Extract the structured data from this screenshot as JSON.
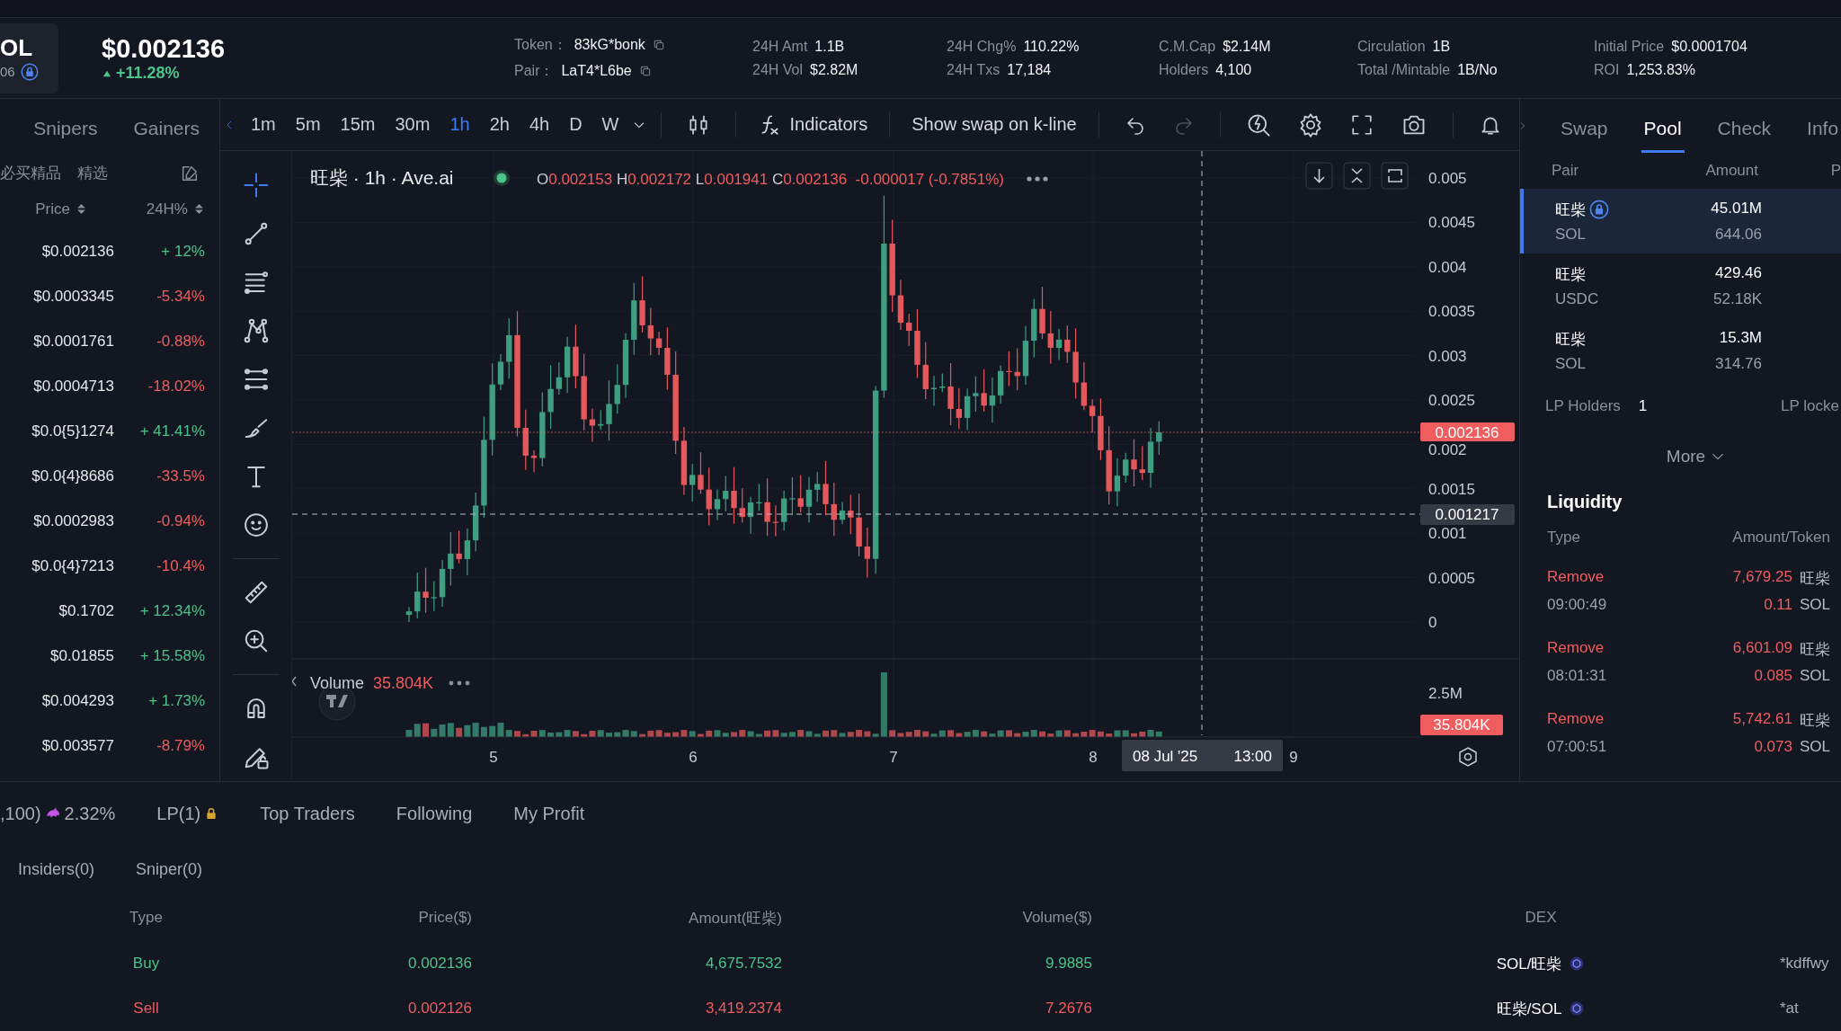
{
  "header": {
    "token_symbol": "OL",
    "token_sub": "06",
    "token_locked": true,
    "price": "$0.002136",
    "change": "+11.28%",
    "stats": [
      [
        {
          "label": "Token：",
          "value": "83kG*bonk",
          "copyable": true
        },
        {
          "label": "Pair：",
          "value": "LaT4*L6be",
          "copyable": true
        }
      ],
      [
        {
          "label": "24H Amt",
          "value": "1.1B",
          "copyable": false
        },
        {
          "label": "24H Vol",
          "value": "$2.82M",
          "copyable": false
        }
      ],
      [
        {
          "label": "24H Chg%",
          "value": "110.22%",
          "copyable": false
        },
        {
          "label": "24H Txs",
          "value": "17,184",
          "copyable": false
        }
      ],
      [
        {
          "label": "C.M.Cap",
          "value": "$2.14M",
          "copyable": false
        },
        {
          "label": "Holders",
          "value": "4,100",
          "copyable": false
        }
      ],
      [
        {
          "label": "Circulation",
          "value": "1B",
          "copyable": false
        },
        {
          "label": "Total /Mintable",
          "value": "1B/No",
          "copyable": false
        }
      ],
      [
        {
          "label": "Initial Price",
          "value": "$0.0001704",
          "copyable": false
        },
        {
          "label": "ROI",
          "value": "1,253.83%",
          "copyable": false
        }
      ]
    ]
  },
  "left_panel": {
    "tabs": [
      "Snipers",
      "Gainers"
    ],
    "filters": [
      "必买精品",
      "精选"
    ],
    "columns": [
      "Price",
      "24H%"
    ],
    "rows": [
      {
        "price": "$0.002136",
        "change": "+ 12%",
        "color": "#4cc38a"
      },
      {
        "price": "$0.0003345",
        "change": "-5.34%",
        "color": "#f05d5e"
      },
      {
        "price": "$0.0001761",
        "change": "-0.88%",
        "color": "#f05d5e"
      },
      {
        "price": "$0.0004713",
        "change": "-18.02%",
        "color": "#f05d5e"
      },
      {
        "price": "$0.0{5}1274",
        "change": "+ 41.41%",
        "color": "#4cc38a"
      },
      {
        "price": "$0.0{4}8686",
        "change": "-33.5%",
        "color": "#f05d5e"
      },
      {
        "price": "$0.0002983",
        "change": "-0.94%",
        "color": "#f05d5e"
      },
      {
        "price": "$0.0{4}7213",
        "change": "-10.4%",
        "color": "#f05d5e"
      },
      {
        "price": "$0.1702",
        "change": "+ 12.34%",
        "color": "#4cc38a"
      },
      {
        "price": "$0.01855",
        "change": "+ 15.58%",
        "color": "#4cc38a"
      },
      {
        "price": "$0.004293",
        "change": "+ 1.73%",
        "color": "#4cc38a"
      },
      {
        "price": "$0.003577",
        "change": "-8.79%",
        "color": "#f05d5e"
      }
    ]
  },
  "chart": {
    "timeframes": [
      {
        "label": "1m",
        "selected": false
      },
      {
        "label": "5m",
        "selected": false
      },
      {
        "label": "15m",
        "selected": false
      },
      {
        "label": "30m",
        "selected": false
      },
      {
        "label": "1h",
        "selected": true
      },
      {
        "label": "2h",
        "selected": false
      },
      {
        "label": "4h",
        "selected": false
      },
      {
        "label": "D",
        "selected": false
      },
      {
        "label": "W",
        "selected": false
      }
    ],
    "indicators_label": "Indicators",
    "swap_toggle_label": "Show swap on k-line",
    "title": "旺柴 · 1h · Ave.ai",
    "ohlc": [
      {
        "key": "O",
        "value": "0.002153"
      },
      {
        "key": "H",
        "value": "0.002172"
      },
      {
        "key": "L",
        "value": "0.001941"
      },
      {
        "key": "C",
        "value": "0.002136"
      }
    ],
    "change": "-0.000017 (-0.7851%)",
    "price_ticks": [
      "0.005",
      "0.0045",
      "0.004",
      "0.0035",
      "0.003",
      "0.0025",
      "0.002",
      "0.0015",
      "0.001",
      "0.0005",
      "0"
    ],
    "last_price": "0.002136",
    "crosshair_price": "0.001217",
    "volume_label": "Volume",
    "volume_value": "35.804K",
    "volume_tick": "2.5M",
    "volume_tag": "35.804K",
    "x_ticks": [
      "5",
      "6",
      "7",
      "8",
      "9"
    ],
    "crosshair_date": "08 Jul '25",
    "crosshair_hour": "13:00"
  },
  "right_panel": {
    "tabs": [
      {
        "label": "Swap",
        "selected": false
      },
      {
        "label": "Pool",
        "selected": true
      },
      {
        "label": "Check",
        "selected": false
      },
      {
        "label": "Info",
        "selected": false
      }
    ],
    "pool_columns": [
      "Pair",
      "Amount",
      "P"
    ],
    "pools": [
      {
        "base": "旺柴",
        "quote": "SOL",
        "amount": "45.01M",
        "quote_amount": "644.06",
        "locked": true,
        "selected": true
      },
      {
        "base": "旺柴",
        "quote": "USDC",
        "amount": "429.46",
        "quote_amount": "52.18K",
        "locked": false,
        "selected": false
      },
      {
        "base": "旺柴",
        "quote": "SOL",
        "amount": "15.3M",
        "quote_amount": "314.76",
        "locked": false,
        "selected": false
      }
    ],
    "lp_holders_label": "LP Holders",
    "lp_holders_value": "1",
    "lp_locked_label": "LP locke",
    "more": "More",
    "liquidity": {
      "title": "Liquidity",
      "columns": [
        "Type",
        "Amount/Token"
      ],
      "events": [
        {
          "type": "Remove",
          "time": "09:00:49",
          "token_amount": "7,679.25",
          "token": "旺柴",
          "quote_amount": "0.11",
          "quote": "SOL"
        },
        {
          "type": "Remove",
          "time": "08:01:31",
          "token_amount": "6,601.09",
          "token": "旺柴",
          "quote_amount": "0.085",
          "quote": "SOL"
        },
        {
          "type": "Remove",
          "time": "07:00:51",
          "token_amount": "5,742.61",
          "token": "旺柴",
          "quote_amount": "0.073",
          "quote": "SOL"
        }
      ]
    }
  },
  "bottom": {
    "tabs": [
      {
        "label": ",100)",
        "extra": "2.32%",
        "kind": "holders"
      },
      {
        "label": "LP(1)",
        "kind": "locked"
      },
      {
        "label": "Top Traders",
        "kind": "plain"
      },
      {
        "label": "Following",
        "kind": "plain"
      },
      {
        "label": "My Profit",
        "kind": "plain"
      }
    ],
    "subtabs": [
      "Insiders(0)",
      "Sniper(0)"
    ],
    "columns": [
      "Type",
      "Price($)",
      "Amount(旺柴)",
      "Volume($)",
      "DEX"
    ],
    "trades": [
      {
        "color": "#4cc38a",
        "type": "Buy",
        "price": "0.002136",
        "amount": "4,675.7532",
        "volume": "9.9885",
        "dex": "SOL/旺柴",
        "maker": "*kdffwy"
      },
      {
        "color": "#f05d5e",
        "type": "Sell",
        "price": "0.002126",
        "amount": "3,419.2374",
        "volume": "7.2676",
        "dex": "旺柴/SOL",
        "maker": "*at"
      }
    ]
  }
}
